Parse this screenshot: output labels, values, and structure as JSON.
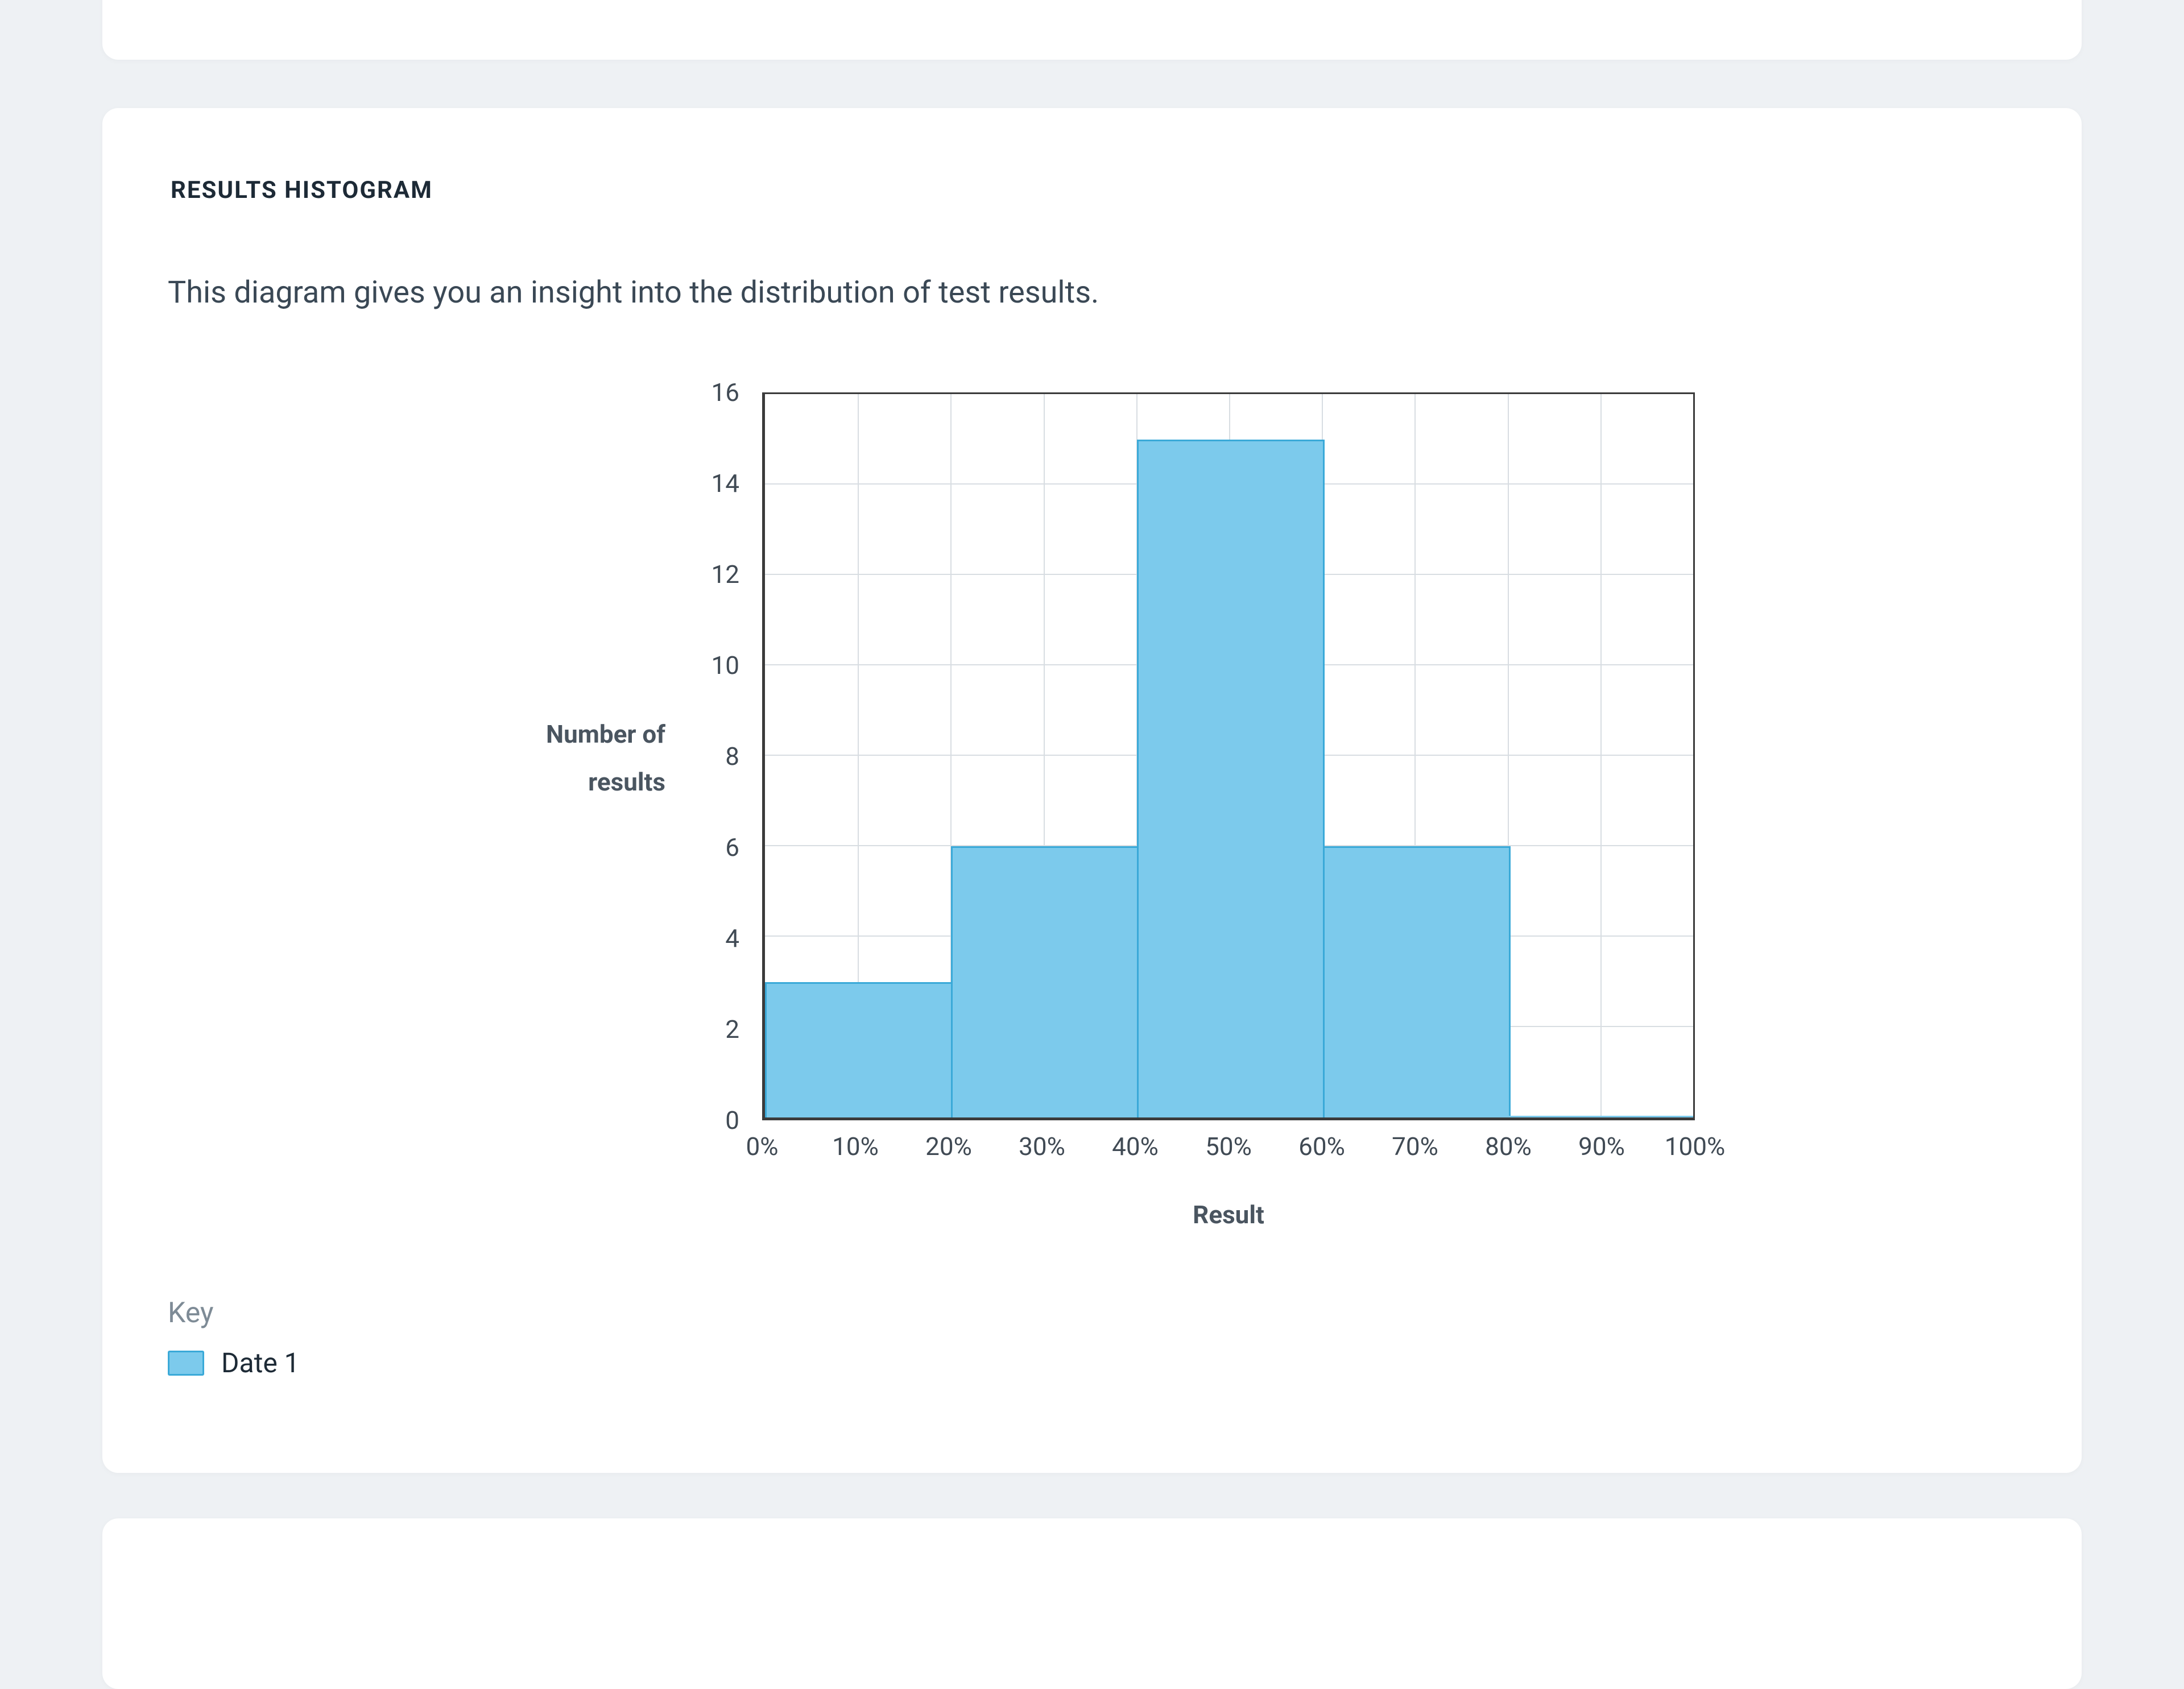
{
  "section": {
    "title": "RESULTS HISTOGRAM",
    "description": "This diagram gives you an insight into the distribution of test results."
  },
  "legend": {
    "title": "Key",
    "items": [
      {
        "label": "Date 1",
        "color": "#7ccaec"
      }
    ]
  },
  "chart_data": {
    "type": "bar",
    "title": "RESULTS HISTOGRAM",
    "xlabel": "Result",
    "ylabel": "Number of results",
    "xticks": [
      "0%",
      "10%",
      "20%",
      "30%",
      "40%",
      "50%",
      "60%",
      "70%",
      "80%",
      "90%",
      "100%"
    ],
    "yticks": [
      0,
      2,
      4,
      6,
      8,
      10,
      12,
      14,
      16
    ],
    "ylim": [
      0,
      16
    ],
    "bins": [
      {
        "range": "0%–20%",
        "value": 3
      },
      {
        "range": "20%–40%",
        "value": 6
      },
      {
        "range": "40%–60%",
        "value": 15
      },
      {
        "range": "60%–80%",
        "value": 6
      },
      {
        "range": "80%–100%",
        "value": 0
      }
    ],
    "series": [
      {
        "name": "Date 1",
        "values": [
          3,
          6,
          15,
          6,
          0
        ]
      }
    ]
  }
}
